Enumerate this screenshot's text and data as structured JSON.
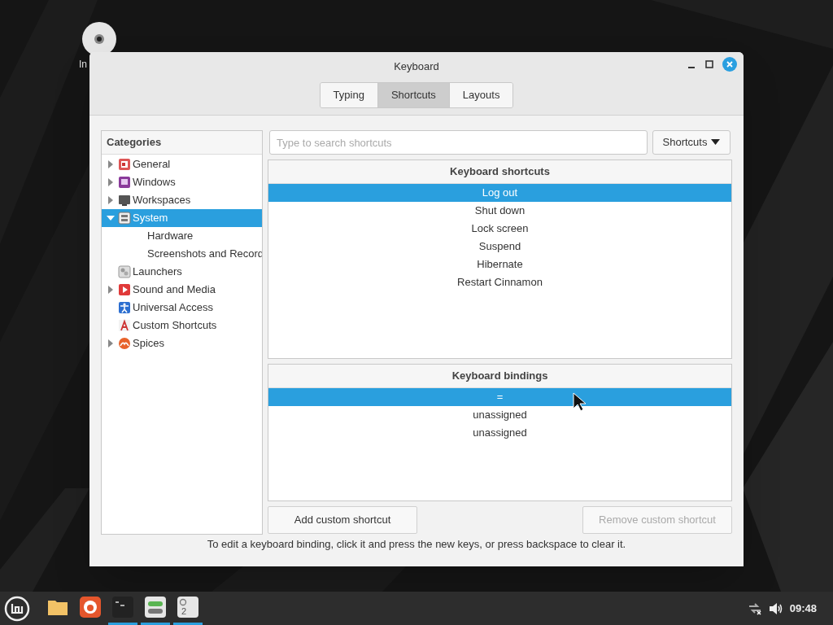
{
  "desktop_icon": {
    "label": "In"
  },
  "window": {
    "title": "Keyboard"
  },
  "tabs": [
    {
      "label": "Typing",
      "selected": false
    },
    {
      "label": "Shortcuts",
      "selected": true
    },
    {
      "label": "Layouts",
      "selected": false
    }
  ],
  "categories": {
    "heading": "Categories",
    "items": [
      {
        "label": "General",
        "expanded": false,
        "selected": false
      },
      {
        "label": "Windows",
        "expanded": false,
        "selected": false
      },
      {
        "label": "Workspaces",
        "expanded": false,
        "selected": false
      },
      {
        "label": "System",
        "expanded": true,
        "selected": true,
        "children": [
          {
            "label": "Hardware",
            "selected": false
          },
          {
            "label": "Screenshots and Record",
            "selected": false
          }
        ]
      },
      {
        "label": "Launchers",
        "selected": false
      },
      {
        "label": "Sound and Media",
        "expanded": false,
        "selected": false
      },
      {
        "label": "Universal Access",
        "selected": false
      },
      {
        "label": "Custom Shortcuts",
        "selected": false
      },
      {
        "label": "Spices",
        "expanded": false,
        "selected": false
      }
    ]
  },
  "search": {
    "placeholder": "Type to search shortcuts"
  },
  "filter_dropdown": {
    "label": "Shortcuts"
  },
  "shortcuts": {
    "heading": "Keyboard shortcuts",
    "rows": [
      {
        "label": "Log out",
        "selected": true
      },
      {
        "label": "Shut down",
        "selected": false
      },
      {
        "label": "Lock screen",
        "selected": false
      },
      {
        "label": "Suspend",
        "selected": false
      },
      {
        "label": "Hibernate",
        "selected": false
      },
      {
        "label": "Restart Cinnamon",
        "selected": false
      }
    ]
  },
  "bindings": {
    "heading": "Keyboard bindings",
    "rows": [
      {
        "label": "=",
        "selected": true
      },
      {
        "label": "unassigned",
        "selected": false
      },
      {
        "label": "unassigned",
        "selected": false
      }
    ]
  },
  "buttons": [
    {
      "label": "Add custom shortcut",
      "disabled": false
    },
    {
      "label": "Remove custom shortcut",
      "disabled": true
    }
  ],
  "hint": "To edit a keyboard binding, click it and press the new keys, or press backspace to clear it.",
  "taskbar": {
    "items": [
      {
        "kind": "folder",
        "active": false
      },
      {
        "kind": "browser",
        "active": false
      },
      {
        "kind": "terminal",
        "active": true
      },
      {
        "kind": "settings",
        "active": true
      },
      {
        "kind": "workspace",
        "label": "2",
        "active": true
      }
    ],
    "clock": "09:48"
  }
}
